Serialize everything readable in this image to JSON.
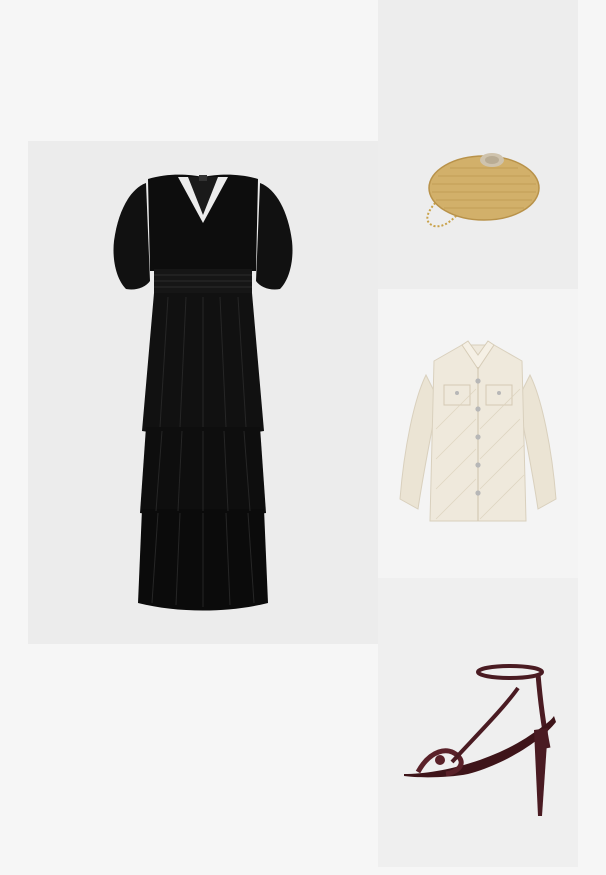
{
  "outfit": {
    "items": [
      {
        "id": "dress",
        "icon": "tiered-maxi-dress-image",
        "color": "#111111"
      },
      {
        "id": "clutch",
        "icon": "straw-clutch-bag-image",
        "color": "#d2b06a"
      },
      {
        "id": "jacket",
        "icon": "cream-shirt-jacket-image",
        "color": "#efe9dc"
      },
      {
        "id": "sandal",
        "icon": "strappy-heel-sandal-image",
        "color": "#4a1b22"
      }
    ]
  }
}
